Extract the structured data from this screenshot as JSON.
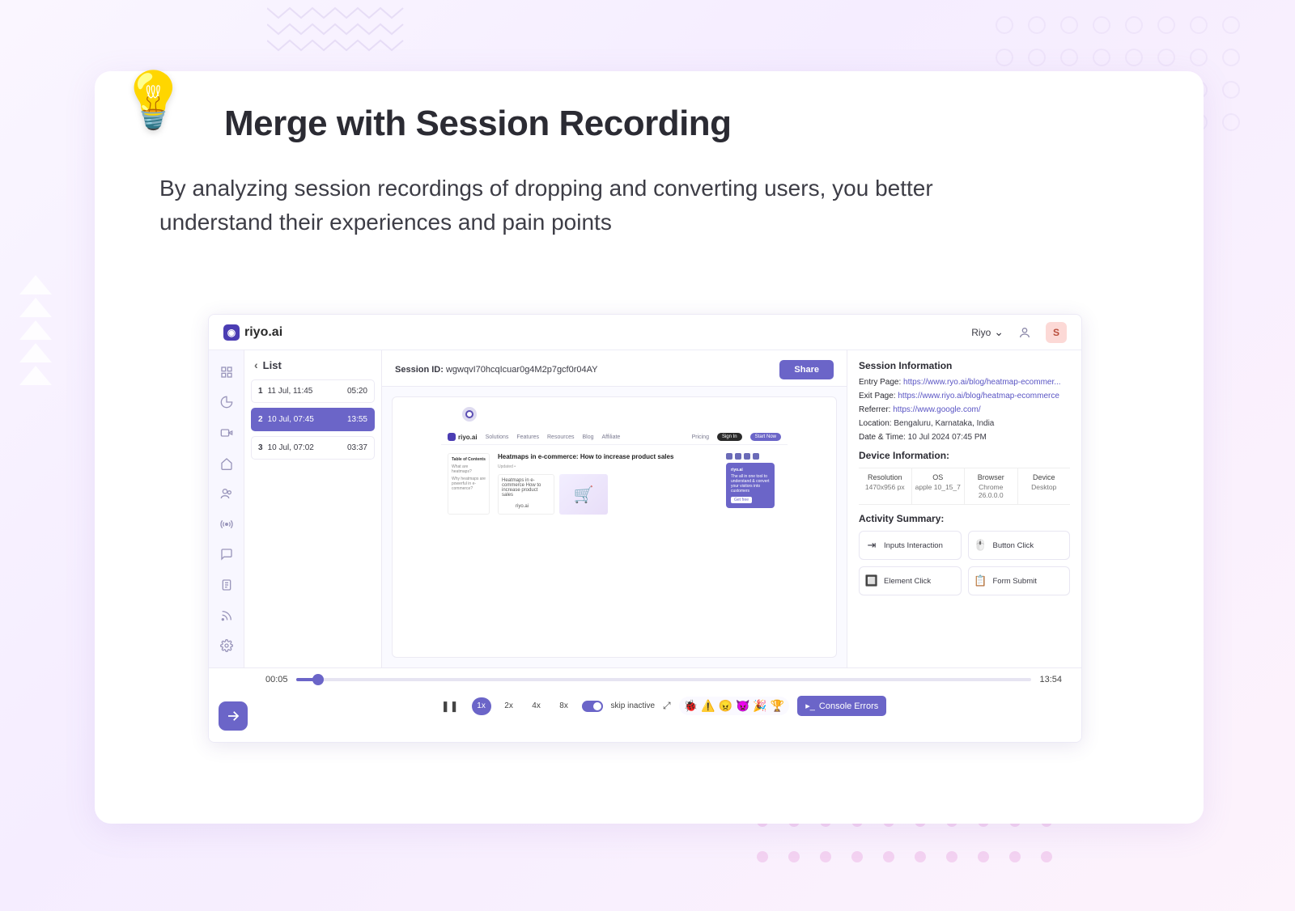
{
  "feature": {
    "title": "Merge with Session Recording",
    "description": "By analyzing session recordings of dropping and converting users, you better understand their experiences and pain points"
  },
  "app": {
    "brand": "riyo.ai",
    "workspace": "Riyo",
    "avatar_initial": "S",
    "sessions_list": {
      "title": "List",
      "items": [
        {
          "idx": "1",
          "dt": "11 Jul, 11:45",
          "dur": "05:20"
        },
        {
          "idx": "2",
          "dt": "10 Jul, 07:45",
          "dur": "13:55"
        },
        {
          "idx": "3",
          "dt": "10 Jul, 07:02",
          "dur": "03:37"
        }
      ]
    },
    "session": {
      "id_label": "Session ID:",
      "id_value": "wgwqvI70hcqIcuar0g4M2p7gcf0r04AY",
      "share_label": "Share"
    },
    "preview": {
      "nav": {
        "pricing": "Pricing",
        "signin": "Sign In",
        "start": "Start Now"
      },
      "nav_items": [
        "Solutions",
        "Features",
        "Resources",
        "Blog",
        "Affiliate"
      ],
      "article_title": "Heatmaps in e-commerce: How to increase product sales",
      "toc_title": "Table of Contents",
      "hero_text": "Heatmaps in e-commerce How to increase product sales",
      "side_title": "riyo.ai",
      "side_btn": "Get free"
    },
    "info": {
      "section_title": "Session Information",
      "entry_label": "Entry Page:",
      "entry_value": "https://www.ryo.ai/blog/heatmap-ecommer...",
      "exit_label": "Exit Page:",
      "exit_value": "https://www.riyo.ai/blog/heatmap-ecommerce",
      "referrer_label": "Referrer:",
      "referrer_value": "https://www.google.com/",
      "location_label": "Location:",
      "location_value": "Bengaluru, Karnataka, India",
      "datetime_label": "Date & Time:",
      "datetime_value": "10 Jul 2024 07:45 PM"
    },
    "device": {
      "section_title": "Device Information:",
      "resolution_h": "Resolution",
      "resolution_v": "1470x956 px",
      "os_h": "OS",
      "os_v": "apple 10_15_7",
      "browser_h": "Browser",
      "browser_v": "Chrome 26.0.0.0",
      "device_h": "Device",
      "device_v": "Desktop"
    },
    "activity": {
      "section_title": "Activity Summary:",
      "inputs": "Inputs Interaction",
      "button": "Button Click",
      "element": "Element Click",
      "form": "Form Submit"
    },
    "player": {
      "current": "00:05",
      "total": "13:54",
      "speed_1x": "1x",
      "speed_2x": "2x",
      "speed_4x": "4x",
      "speed_8x": "8x",
      "skip_label": "skip inactive",
      "console_label": "Console Errors"
    }
  }
}
